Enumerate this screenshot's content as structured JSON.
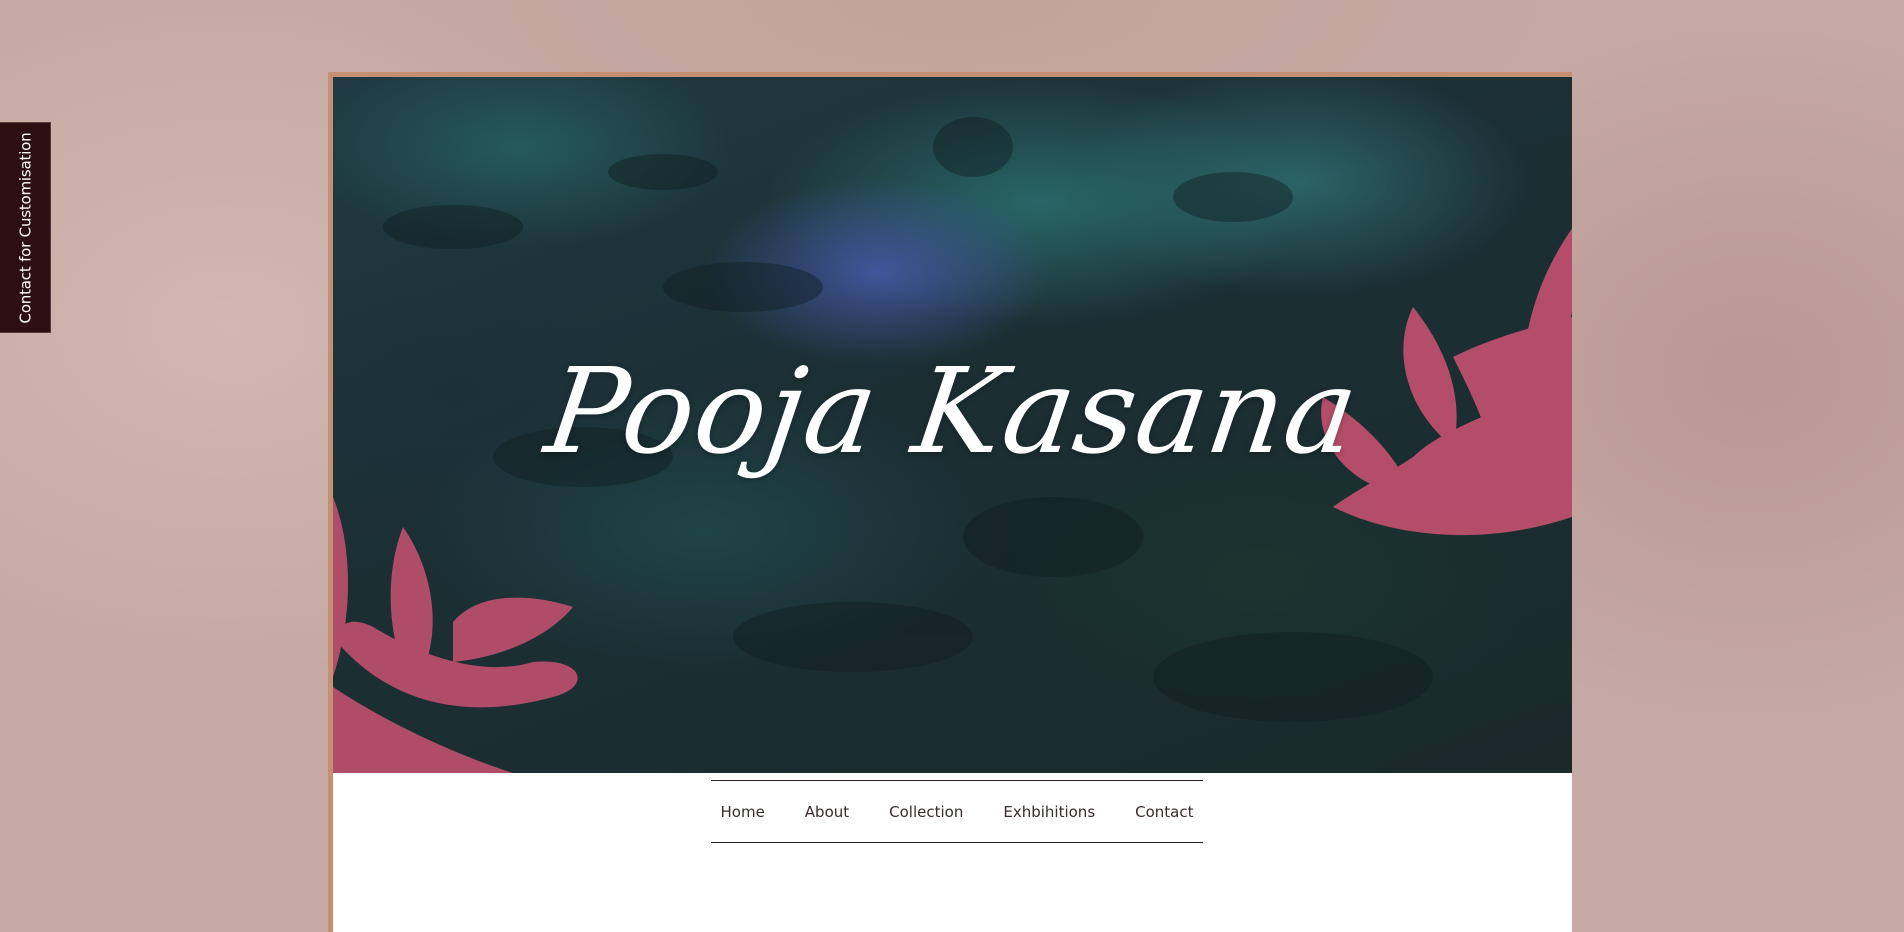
{
  "side_tab": {
    "label": "Contact for Customisation"
  },
  "hero": {
    "title": "Pooja Kasana"
  },
  "nav": {
    "items": [
      {
        "label": "Home"
      },
      {
        "label": "About"
      },
      {
        "label": "Collection"
      },
      {
        "label": "Exhbihitions"
      },
      {
        "label": "Contact"
      }
    ]
  },
  "colors": {
    "side_tab_bg": "#2c0f10",
    "page_frame": "#c48f72",
    "flower_pink": "#c0506e",
    "nav_text": "#3a2c2c"
  }
}
